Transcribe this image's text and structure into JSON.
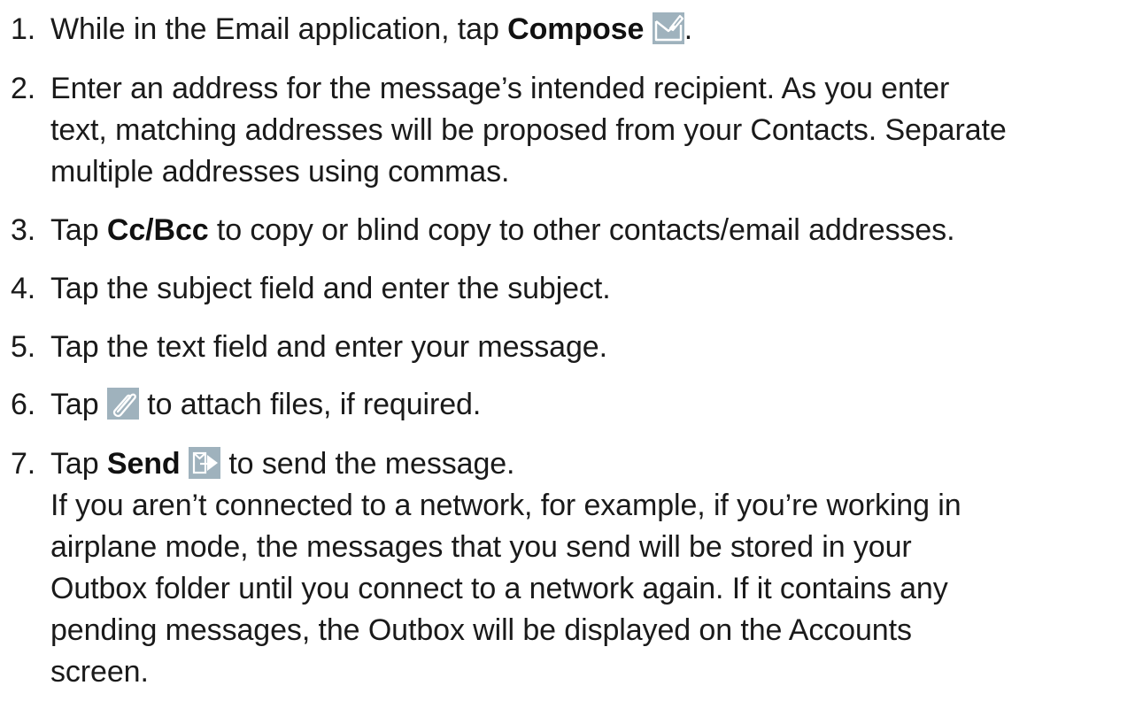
{
  "steps": [
    {
      "num": "1.",
      "before": "While in the Email application, tap ",
      "bold": "Compose",
      "after": "."
    },
    {
      "num": "2.",
      "lines": [
        "Enter an address for the message’s intended recipient. As you enter",
        "text, matching addresses will be proposed from your Contacts. Separate",
        "multiple addresses using commas."
      ]
    },
    {
      "num": "3.",
      "before": "Tap ",
      "bold": "Cc/Bcc",
      "after": " to copy or blind copy to other contacts/email addresses."
    },
    {
      "num": "4.",
      "text": "Tap the subject field and enter the subject."
    },
    {
      "num": "5.",
      "text": "Tap the text field and enter your message."
    },
    {
      "num": "6.",
      "before": "Tap ",
      "after": " to attach files, if required."
    },
    {
      "num": "7.",
      "before": "Tap ",
      "bold": "Send",
      "after": " to send the message.",
      "note_lines": [
        "If you aren’t connected to a network, for example, if you’re working in",
        "airplane mode, the messages that you send will be stored in your",
        "Outbox folder until you connect to a network again. If it contains any",
        "pending messages, the Outbox will be displayed on the Accounts",
        "screen."
      ]
    }
  ],
  "icons": {
    "compose": "compose-icon",
    "attach": "paperclip-icon",
    "send": "send-icon",
    "icon_bg": "#9fb2bd"
  }
}
